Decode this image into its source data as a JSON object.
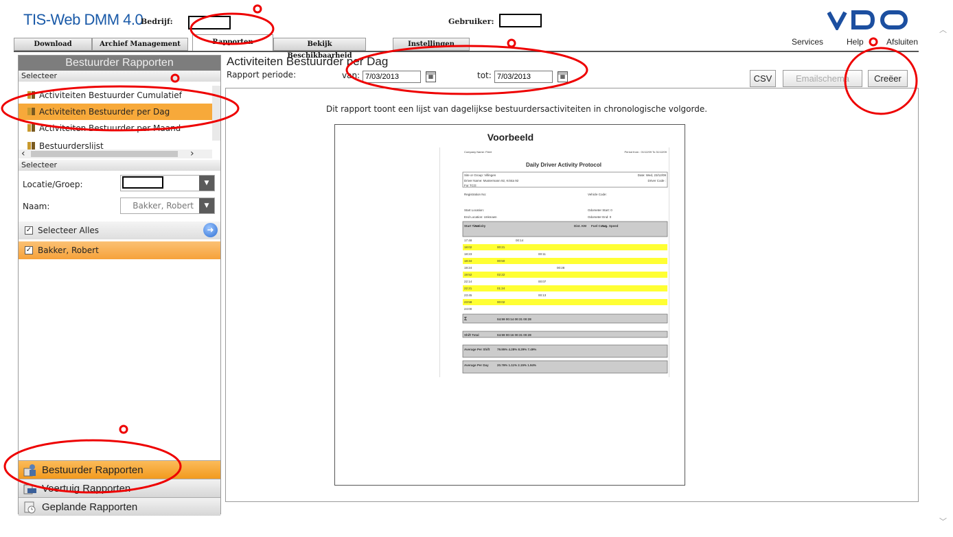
{
  "header": {
    "app_title": "TIS-Web DMM 4.0",
    "company_label": "Bedrijf:",
    "user_label": "Gebruiker:",
    "brand": "VDO"
  },
  "nav_tabs": [
    {
      "label": "Download"
    },
    {
      "label": "Archief Management"
    },
    {
      "label": "Rapporten"
    },
    {
      "label": "Bekijk Beschikbaarheid"
    },
    {
      "label": "Instellingen"
    }
  ],
  "top_links": {
    "services": "Services",
    "help": "Help",
    "close": "Afsluiten"
  },
  "sidebar": {
    "title": "Bestuurder Rapporten",
    "select_label": "Selecteer",
    "reports": [
      {
        "label": "Activiteiten Bestuurder Cumulatief"
      },
      {
        "label": "Activiteiten Bestuurder per Dag"
      },
      {
        "label": "Activiteiten Bestuurder per Maand"
      },
      {
        "label": "Bestuurderslijst"
      }
    ],
    "select_label_2": "Selecteer",
    "location_label": "Locatie/Groep:",
    "name_label": "Naam:",
    "name_value": "Bakker, Robert",
    "select_all": "Selecteer Alles",
    "driver": "Bakker, Robert",
    "nav": [
      {
        "label": "Bestuurder Rapporten"
      },
      {
        "label": "Voertuig Rapporten"
      },
      {
        "label": "Geplande Rapporten"
      }
    ]
  },
  "main": {
    "title": "Activiteiten Bestuurder per Dag",
    "period_label": "Rapport periode:",
    "from_label": "van:",
    "from_date": "7/03/2013",
    "to_label": "tot:",
    "to_date": "7/03/2013",
    "csv_button": "CSV",
    "email_button": "Emailschema",
    "create_button": "Creëer",
    "description": "Dit rapport toont een lijst van dagelijkse bestuurdersactiviteiten in chronologische volgorde.",
    "preview_title": "Voorbeeld"
  },
  "sample": {
    "company": "Company Name: Fleet",
    "period": "Period from : 01/12/09 To 31/12/09",
    "title": "Daily Driver Activity Protocol",
    "site": "Site or Group: Villingen",
    "date": "Date: Wed, 23/12/09",
    "driver": "Driver Name: Mustermann 92, Krista 92",
    "driver_code": "Driver Code :",
    "for_tco": "For TCO:",
    "registration": "Registration No:",
    "vehicle_code": "Vehicle Code:",
    "start_location": "Start Location:",
    "odo_start": "Odometer Start: 0",
    "end_location": "End Location: Unknown",
    "odo_end": "Odometer End: 0",
    "col_start": "Start Time",
    "col_activity": "Activity",
    "col_dist": "Dist. KM",
    "col_fuel": "Fuel Cons.",
    "col_speed": "Avg. Speed",
    "rows": [
      {
        "time": "17:48",
        "a": "",
        "b": "00:14",
        "c": "",
        "d": "",
        "hl": false
      },
      {
        "time": "18:02",
        "a": "00:21",
        "b": "",
        "c": "",
        "d": "",
        "hl": true
      },
      {
        "time": "18:23",
        "a": "",
        "b": "",
        "c": "00:11",
        "d": "",
        "hl": false
      },
      {
        "time": "18:34",
        "a": "00:50",
        "b": "",
        "c": "",
        "d": "",
        "hl": true
      },
      {
        "time": "19:24",
        "a": "",
        "b": "",
        "c": "",
        "d": "00:28",
        "hl": false
      },
      {
        "time": "19:52",
        "a": "02:22",
        "b": "",
        "c": "",
        "d": "",
        "hl": true
      },
      {
        "time": "22:14",
        "a": "",
        "b": "",
        "c": "00:07",
        "d": "",
        "hl": false
      },
      {
        "time": "22:21",
        "a": "01:24",
        "b": "",
        "c": "",
        "d": "",
        "hl": true
      },
      {
        "time": "23:45",
        "a": "",
        "b": "",
        "c": "00:13",
        "d": "",
        "hl": false
      },
      {
        "time": "23:58",
        "a": "00:02",
        "b": "",
        "c": "",
        "d": "",
        "hl": true
      },
      {
        "time": "24:00",
        "a": "",
        "b": "",
        "c": "",
        "d": "",
        "hl": false
      }
    ],
    "sum_row": "04:59   00:14   00:31   00:28",
    "shift_label": "Shift Total",
    "shift_values": "04:59   00:16   00:31   00:28",
    "avg_shift_label": "Average Per Shift",
    "avg_shift_values": "79.95%   4.28%   8.29%   7.49%",
    "avg_day_label": "Average Per Day",
    "avg_day_values": "20.76%   1.11%   2.15%   1.94%"
  },
  "colors": {
    "accent": "#f7a93a",
    "title": "#1a5aa8",
    "annotation": "#e00000"
  }
}
